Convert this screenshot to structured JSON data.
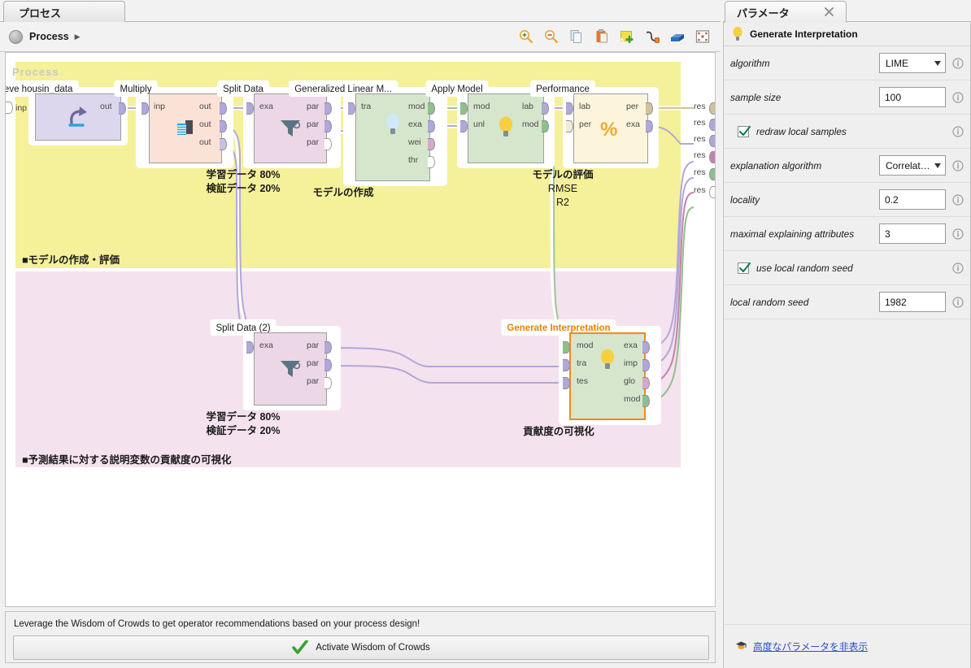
{
  "process_panel": {
    "tab_label": "プロセス",
    "breadcrumb": {
      "label": "Process",
      "arrow": "▶"
    },
    "toolbar_icons": [
      "zoom-in-icon",
      "zoom-out-icon",
      "copy-icon",
      "paste-icon",
      "add-note-icon",
      "auto-wire-icon",
      "layers-icon",
      "fit-to-screen-icon"
    ],
    "watermark": "Process"
  },
  "canvas": {
    "regions": [
      {
        "name": "model-build-eval",
        "title": "■モデルの作成・評価",
        "color": "#f5f09a"
      },
      {
        "name": "contribution-viz",
        "title": "■予測結果に対する説明変数の貢献度の可視化",
        "color": "#f5e2ef"
      }
    ],
    "inp_label": "inp",
    "res_label": "res",
    "res_count": 6,
    "operators": [
      {
        "id": "retrieve",
        "title": "Retrieve housin_data",
        "icon": "retrieve-icon",
        "in_ports": [],
        "out_ports": [
          "out"
        ],
        "note": ""
      },
      {
        "id": "multiply",
        "title": "Multiply",
        "icon": "multiply-icon",
        "in_ports": [
          "inp"
        ],
        "out_ports": [
          "out",
          "out",
          "out"
        ],
        "note": ""
      },
      {
        "id": "split-data",
        "title": "Split Data",
        "icon": "filter-funnel-icon",
        "in_ports": [
          "exa"
        ],
        "out_ports": [
          "par",
          "par",
          "par"
        ],
        "note_lines": [
          "学習データ 80%",
          "検証データ 20%"
        ]
      },
      {
        "id": "glm",
        "title": "Generalized Linear M...",
        "icon": "bulb-blue-icon",
        "in_ports": [
          "tra"
        ],
        "out_ports": [
          "mod",
          "exa",
          "wei",
          "thr"
        ],
        "note_lines": [
          "モデルの作成"
        ]
      },
      {
        "id": "apply-model",
        "title": "Apply Model",
        "icon": "bulb-yellow-icon",
        "in_ports": [
          "mod",
          "unl"
        ],
        "out_ports": [
          "lab",
          "mod"
        ],
        "note_lines": []
      },
      {
        "id": "performance",
        "title": "Performance",
        "icon": "percent-icon",
        "in_ports": [
          "lab",
          "per"
        ],
        "out_ports": [
          "per",
          "exa"
        ],
        "note_lines": [
          "モデルの評価",
          "RMSE",
          "R2"
        ]
      },
      {
        "id": "split-data-2",
        "title": "Split Data (2)",
        "icon": "filter-funnel-icon",
        "in_ports": [
          "exa"
        ],
        "out_ports": [
          "par",
          "par",
          "par"
        ],
        "note_lines": [
          "学習データ 80%",
          "検証データ 20%"
        ]
      },
      {
        "id": "generate-interpretation",
        "title": "Generate Interpretation",
        "icon": "bulb-yellow-icon",
        "selected": true,
        "in_ports": [
          "mod",
          "tra",
          "tes"
        ],
        "out_ports": [
          "exa",
          "imp",
          "glo",
          "mod"
        ],
        "note_lines": [
          "貢献度の可視化"
        ]
      }
    ]
  },
  "wisdom": {
    "message": "Leverage the Wisdom of Crowds to get operator recommendations based on your process design!",
    "button_label": "Activate Wisdom of Crowds",
    "button_icon": "green-check-icon"
  },
  "parameters": {
    "tab_label": "パラメータ",
    "close_icon": "close-icon",
    "operator_icon": "bulb-yellow-icon",
    "operator_name": "Generate Interpretation",
    "rows": [
      {
        "kind": "combo",
        "label": "algorithm",
        "value": "LIME",
        "info": "info-icon"
      },
      {
        "kind": "text",
        "label": "sample size",
        "value": "100",
        "info": "info-icon"
      },
      {
        "kind": "checkbox",
        "label": "redraw local samples",
        "checked": true,
        "info": "info-icon"
      },
      {
        "kind": "combo",
        "label": "explanation algorithm",
        "value": "Correlat…",
        "info": "info-icon"
      },
      {
        "kind": "text",
        "label": "locality",
        "value": "0.2",
        "info": "info-icon"
      },
      {
        "kind": "text",
        "label": "maximal explaining attributes",
        "value": "3",
        "info": "info-icon"
      },
      {
        "kind": "checkbox",
        "label": "use local random seed",
        "checked": true,
        "info": "info-icon"
      },
      {
        "kind": "text",
        "label": "local random seed",
        "value": "1982",
        "info": "info-icon"
      }
    ],
    "footer": {
      "icon": "expert-hat-icon",
      "link_label": "高度なパラメータを非表示"
    }
  },
  "colors": {
    "region_yellow": "#f5f09a",
    "region_pink": "#f5e2ef",
    "op_purple": "#ddd7ee",
    "op_peach": "#fbe2d6",
    "op_pink": "#ecd7e7",
    "op_green": "#d5e6cd",
    "op_cream": "#fcf5db",
    "selected_orange": "#f08a1d",
    "link_blue": "#2a4fc4"
  }
}
